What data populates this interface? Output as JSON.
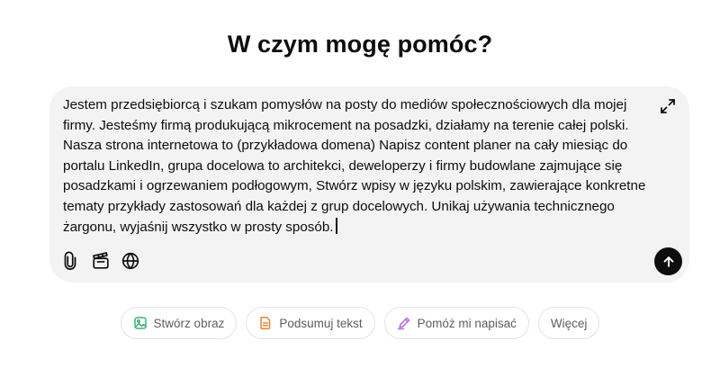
{
  "heading": "W czym mogę pomóc?",
  "composer": {
    "text": "Jestem przedsiębiorcą i szukam pomysłów na posty do mediów społecznościowych dla mojej firmy. Jesteśmy firmą produkującą mikrocement na posadzki, działamy na terenie całej polski. Nasza strona internetowa to (przykładowa domena) Napisz content planer na cały miesiąc do portalu LinkedIn, grupa docelowa to architekci, deweloperzy i firmy budowlane zajmujące się posadzkami i ogrzewaniem podłogowym, Stwórz wpisy w języku polskim, zawierające konkretne tematy przykłady zastosowań dla każdej z grup docelowych. Unikaj używania technicznego żargonu, wyjaśnij wszystko w prosty sposób.",
    "icons": {
      "expand": "expand-arrows-icon",
      "attach": "paperclip-icon",
      "tools": "clapperboard-icon",
      "web": "globe-icon",
      "send": "arrow-up-icon"
    }
  },
  "suggestions": [
    {
      "label": "Stwórz obraz",
      "icon": "image-icon",
      "color": "#3bb273"
    },
    {
      "label": "Podsumuj tekst",
      "icon": "document-icon",
      "color": "#e8833a"
    },
    {
      "label": "Pomóż mi napisać",
      "icon": "pen-icon",
      "color": "#b56ad8"
    },
    {
      "label": "Więcej",
      "icon": "",
      "color": ""
    }
  ],
  "colors": {
    "composer_bg": "#f3f3f3",
    "send_bg": "#0d0d0d",
    "chip_border": "#e3e3e3"
  }
}
